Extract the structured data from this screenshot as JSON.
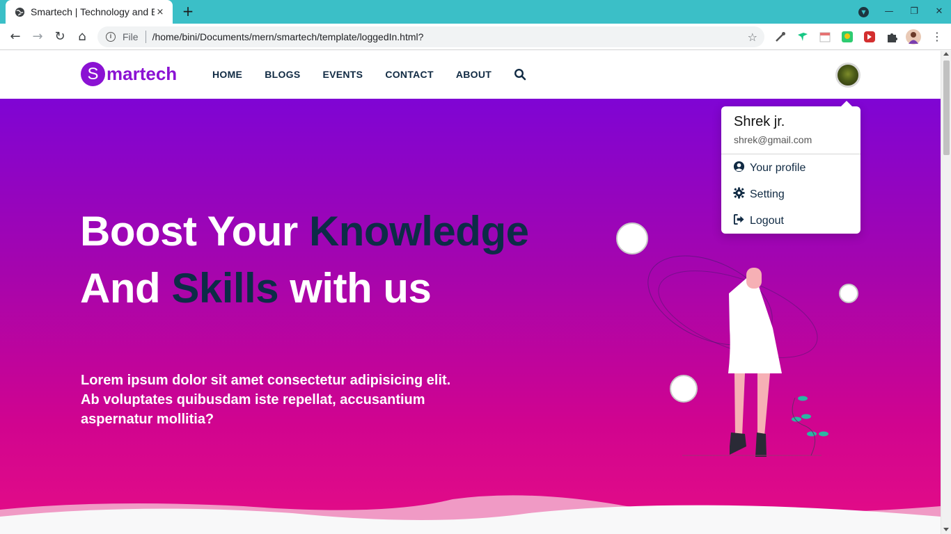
{
  "browser": {
    "tab_title": "Smartech | Technology and Education",
    "new_tab": "+",
    "close_tab": "×",
    "address_scheme_label": "File",
    "url": "/home/bini/Documents/mern/smartech/template/loggedIn.html?"
  },
  "site": {
    "logo_initial": "S",
    "logo_rest": "martech",
    "brand_color": "#8b12d3",
    "nav": [
      {
        "label": "HOME"
      },
      {
        "label": "BLOGS"
      },
      {
        "label": "EVENTS"
      },
      {
        "label": "CONTACT"
      },
      {
        "label": "ABOUT"
      }
    ]
  },
  "hero": {
    "line1_a": "Boost Your ",
    "line1_b": "Knowledge",
    "line2_a": "And ",
    "line2_b": "Skills",
    "line2_c": " with us",
    "description": "Lorem ipsum dolor sit amet consectetur adipisicing elit. Ab voluptates quibusdam iste repellat, accusantium aspernatur mollitia?",
    "gradient_top": "#7f05d4",
    "gradient_bottom": "#e50d86",
    "accent_dark": "#0d2c47"
  },
  "user_menu": {
    "name": "Shrek jr.",
    "email": "shrek@gmail.com",
    "items": [
      {
        "label": "Your profile",
        "icon": "user-circle-icon"
      },
      {
        "label": "Setting",
        "icon": "gear-icon"
      },
      {
        "label": "Logout",
        "icon": "sign-out-icon"
      }
    ]
  }
}
